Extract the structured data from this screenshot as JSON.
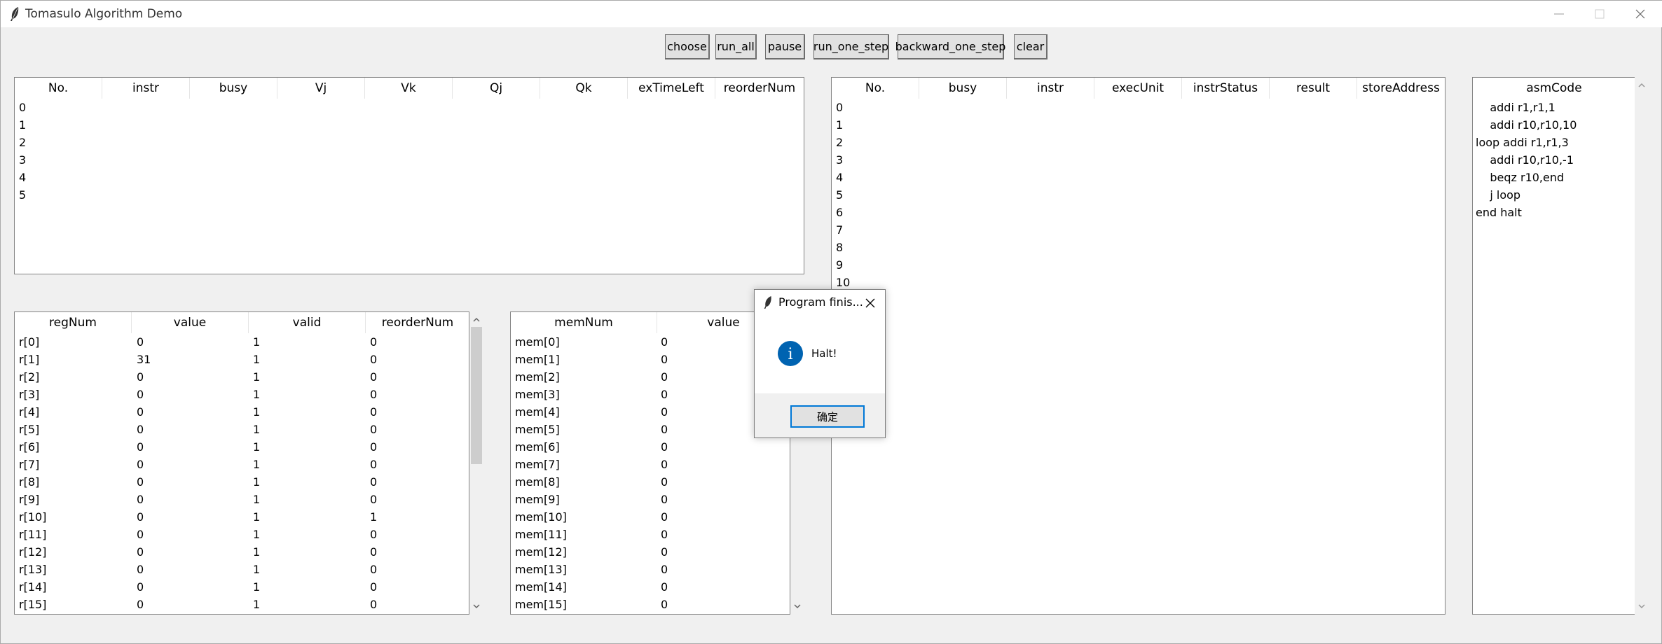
{
  "window": {
    "title": "Tomasulo Algorithm Demo"
  },
  "toolbar": {
    "buttons": [
      "choose",
      "run_all",
      "pause",
      "run_one_step",
      "backward_one_step",
      "clear"
    ]
  },
  "rs_table": {
    "headers": [
      "No.",
      "instr",
      "busy",
      "Vj",
      "Vk",
      "Qj",
      "Qk",
      "exTimeLeft",
      "reorderNum"
    ],
    "rows": [
      "0",
      "1",
      "2",
      "3",
      "4",
      "5"
    ]
  },
  "rob_table": {
    "headers": [
      "No.",
      "busy",
      "instr",
      "execUnit",
      "instrStatus",
      "result",
      "storeAddress"
    ],
    "rows": [
      "0",
      "1",
      "2",
      "3",
      "4",
      "5",
      "6",
      "7",
      "8",
      "9",
      "10"
    ]
  },
  "asm_panel": {
    "header": "asmCode",
    "lines": [
      "    addi r1,r1,1",
      "    addi r10,r10,10",
      "loop addi r1,r1,3",
      "    addi r10,r10,-1",
      "    beqz r10,end",
      "    j loop",
      "end halt"
    ]
  },
  "reg_table": {
    "headers": [
      "regNum",
      "value",
      "valid",
      "reorderNum"
    ],
    "rows": [
      [
        "r[0]",
        "0",
        "1",
        "0"
      ],
      [
        "r[1]",
        "31",
        "1",
        "0"
      ],
      [
        "r[2]",
        "0",
        "1",
        "0"
      ],
      [
        "r[3]",
        "0",
        "1",
        "0"
      ],
      [
        "r[4]",
        "0",
        "1",
        "0"
      ],
      [
        "r[5]",
        "0",
        "1",
        "0"
      ],
      [
        "r[6]",
        "0",
        "1",
        "0"
      ],
      [
        "r[7]",
        "0",
        "1",
        "0"
      ],
      [
        "r[8]",
        "0",
        "1",
        "0"
      ],
      [
        "r[9]",
        "0",
        "1",
        "0"
      ],
      [
        "r[10]",
        "0",
        "1",
        "1"
      ],
      [
        "r[11]",
        "0",
        "1",
        "0"
      ],
      [
        "r[12]",
        "0",
        "1",
        "0"
      ],
      [
        "r[13]",
        "0",
        "1",
        "0"
      ],
      [
        "r[14]",
        "0",
        "1",
        "0"
      ],
      [
        "r[15]",
        "0",
        "1",
        "0"
      ]
    ]
  },
  "mem_table": {
    "headers": [
      "memNum",
      "value"
    ],
    "rows": [
      [
        "mem[0]",
        "0"
      ],
      [
        "mem[1]",
        "0"
      ],
      [
        "mem[2]",
        "0"
      ],
      [
        "mem[3]",
        "0"
      ],
      [
        "mem[4]",
        "0"
      ],
      [
        "mem[5]",
        "0"
      ],
      [
        "mem[6]",
        "0"
      ],
      [
        "mem[7]",
        "0"
      ],
      [
        "mem[8]",
        "0"
      ],
      [
        "mem[9]",
        "0"
      ],
      [
        "mem[10]",
        "0"
      ],
      [
        "mem[11]",
        "0"
      ],
      [
        "mem[12]",
        "0"
      ],
      [
        "mem[13]",
        "0"
      ],
      [
        "mem[14]",
        "0"
      ],
      [
        "mem[15]",
        "0"
      ]
    ]
  },
  "dialog": {
    "title": "Program finis...",
    "message": "Halt!",
    "ok_label": "确定",
    "info_icon_glyph": "i"
  },
  "colors": {
    "accent": "#0078d7",
    "info_icon": "#0063b1"
  }
}
